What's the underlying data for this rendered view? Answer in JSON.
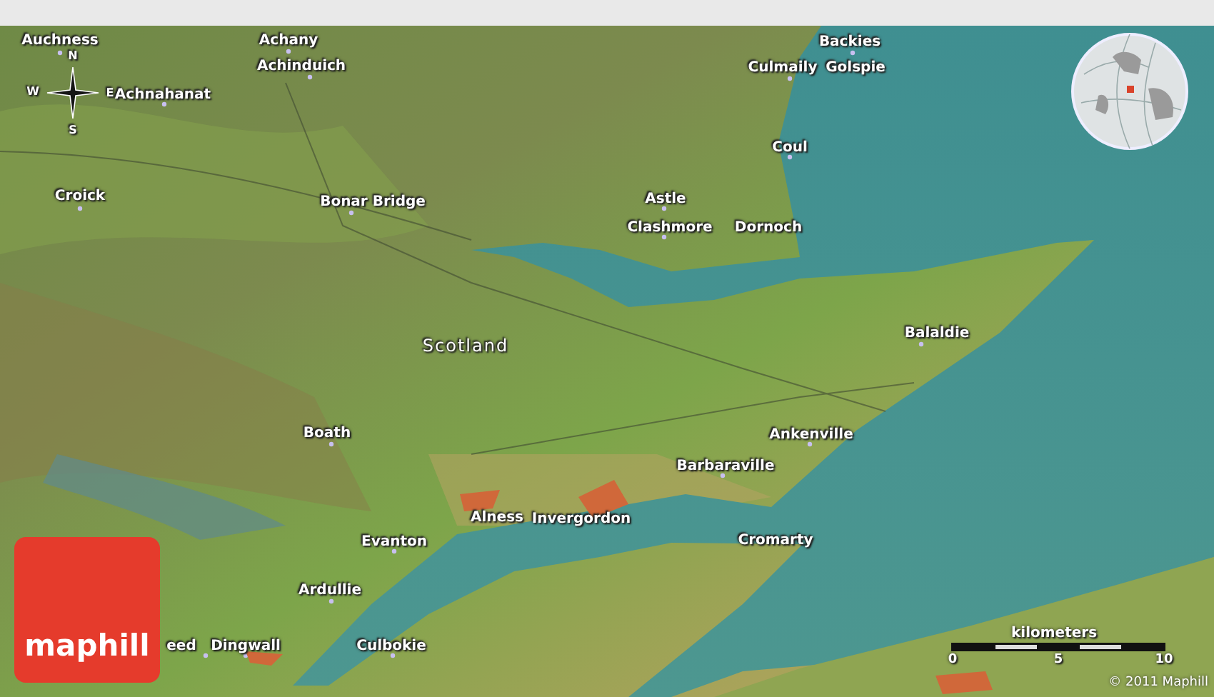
{
  "region_label": "Scotland",
  "places": [
    "Auchness",
    "Achany",
    "Achinduich",
    "Achnahanat",
    "Croick",
    "Bonar Bridge",
    "Backies",
    "Culmaily",
    "Golspie",
    "Coul",
    "Astle",
    "Clashmore",
    "Dornoch",
    "Balaldie",
    "Ankenville",
    "Barbaraville",
    "Boath",
    "Alness",
    "Invergordon",
    "Evanton",
    "Cromarty",
    "Ardullie",
    "eed",
    "Dingwall",
    "Culbokie"
  ],
  "compass": {
    "north": "N",
    "east": "E",
    "south": "S",
    "west": "W"
  },
  "scale": {
    "unit": "kilometers",
    "ticks": [
      "0",
      "5",
      "10"
    ]
  },
  "logo": "maphill",
  "copyright": "© 2011 Maphill"
}
